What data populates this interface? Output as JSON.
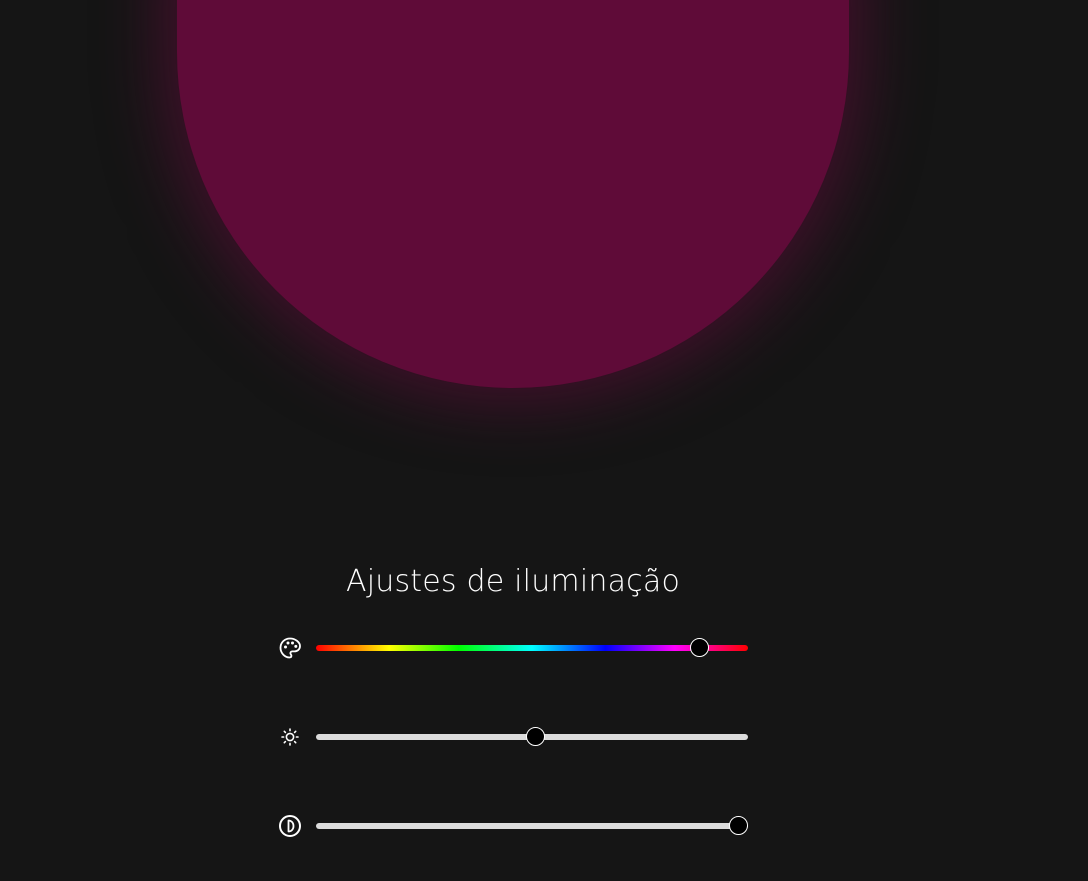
{
  "lamp": {
    "color": "#5f0b38"
  },
  "title": "Ajustes de iluminação",
  "controls": [
    {
      "name": "hue",
      "icon": "palette-icon",
      "value": 0.89
    },
    {
      "name": "brightness",
      "icon": "sun-icon",
      "value": 0.51
    },
    {
      "name": "contrast",
      "icon": "contrast-icon",
      "value": 0.98
    }
  ],
  "colors": {
    "background": "#151515",
    "track": "#dcdcdc",
    "thumb": "#000000",
    "text": "#ffffff"
  }
}
